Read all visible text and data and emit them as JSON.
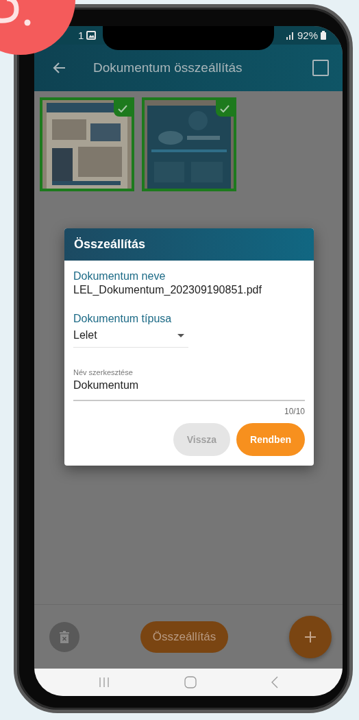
{
  "status_bar": {
    "time": "1",
    "battery": "92%"
  },
  "app_bar": {
    "title": "Dokumentum összeállítás",
    "select_all": {
      "checked": false
    }
  },
  "thumbnails": [
    {
      "kind": "picture",
      "selected": true
    },
    {
      "kind": "picture",
      "selected": true
    }
  ],
  "dialog": {
    "title": "Összeállítás",
    "name_label": "Dokumentum neve",
    "name_value": "LEL_Dokumentum_202309190851.pdf",
    "type_label": "Dokumentum típusa",
    "type_value": "Lelet",
    "edit_label": "Név szerkesztése",
    "edit_value": "Dokumentum",
    "counter": "10/10",
    "buttons": [
      {
        "label": "Vissza",
        "kind": "secondary",
        "disabled": true
      },
      {
        "label": "Rendben",
        "kind": "primary",
        "disabled": false
      }
    ]
  },
  "bottom_bar": {
    "compose_button": "Összeállítás"
  }
}
